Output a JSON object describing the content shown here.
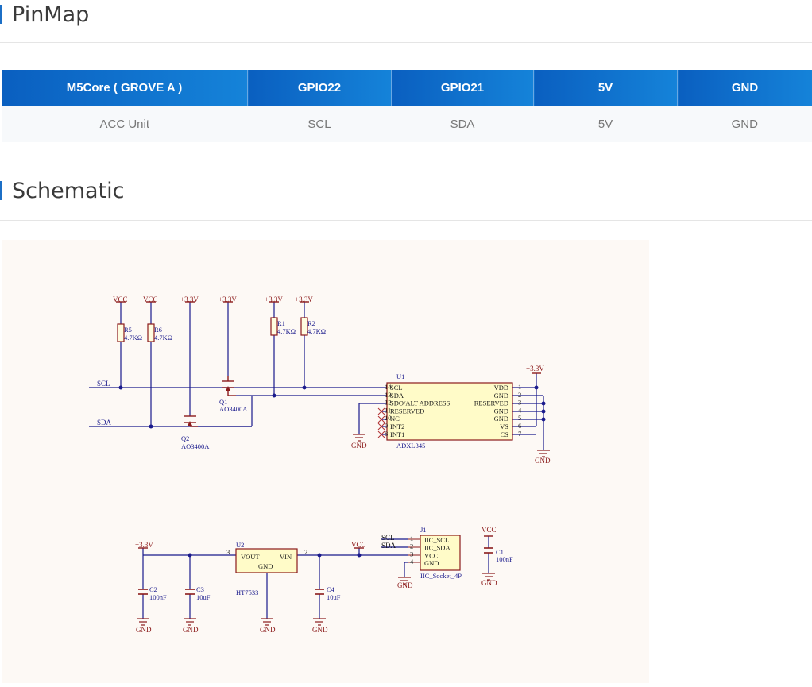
{
  "pinmap": {
    "title": "PinMap",
    "headers": [
      "M5Core ( GROVE A )",
      "GPIO22",
      "GPIO21",
      "5V",
      "GND"
    ],
    "row": [
      "ACC Unit",
      "SCL",
      "SDA",
      "5V",
      "GND"
    ]
  },
  "schematic": {
    "title": "Schematic",
    "labels": {
      "vcc": "VCC",
      "v33": "+3.3V",
      "gnd": "GND",
      "scl": "SCL",
      "sda": "SDA",
      "r5": "R5",
      "r5v": "4.7KΩ",
      "r6": "R6",
      "r6v": "4.7KΩ",
      "r1": "R1",
      "r1v": "4.7KΩ",
      "r2": "R2",
      "r2v": "4.7KΩ",
      "q1": "Q1",
      "q1v": "AO3400A",
      "q2": "Q2",
      "q2v": "AO3400A",
      "u1": "U1",
      "u1v": "ADXL345",
      "u2": "U2",
      "u2v": "HT7533",
      "u2_vout": "VOUT",
      "u2_vin": "VIN",
      "u2_gnd": "GND",
      "u2_p3": "3",
      "u2_p2": "2",
      "c1": "C1",
      "c1v": "100nF",
      "c2": "C2",
      "c2v": "100nF",
      "c3": "C3",
      "c3v": "10uF",
      "c4": "C4",
      "c4v": "10uF",
      "j1": "J1",
      "j1v": "IIC_Socket_4P"
    },
    "u1_left_pins": [
      {
        "num": "14",
        "name": "SCL"
      },
      {
        "num": "13",
        "name": "SDA"
      },
      {
        "num": "12",
        "name": "SDO/ALT ADDRESS"
      },
      {
        "num": "11",
        "name": "RESERVED"
      },
      {
        "num": "10",
        "name": "NC"
      },
      {
        "num": "9",
        "name": "INT2"
      },
      {
        "num": "8",
        "name": "INT1"
      }
    ],
    "u1_right_pins": [
      {
        "num": "1",
        "name": "VDD"
      },
      {
        "num": "2",
        "name": "GND"
      },
      {
        "num": "3",
        "name": "RESERVED"
      },
      {
        "num": "4",
        "name": "GND"
      },
      {
        "num": "5",
        "name": "GND"
      },
      {
        "num": "6",
        "name": "VS"
      },
      {
        "num": "7",
        "name": "CS"
      }
    ],
    "j1_pins": [
      {
        "num": "1",
        "name": "IIC_SCL"
      },
      {
        "num": "2",
        "name": "IIC_SDA"
      },
      {
        "num": "3",
        "name": "VCC"
      },
      {
        "num": "4",
        "name": "GND"
      }
    ]
  }
}
